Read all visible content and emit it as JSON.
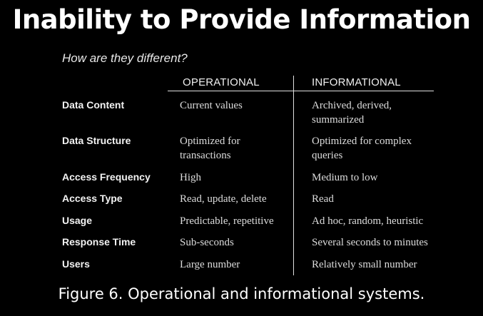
{
  "title": "Inability to Provide Information",
  "subtitle": "How are they different?",
  "columns": {
    "operational": "OPERATIONAL",
    "informational": "INFORMATIONAL"
  },
  "rows": [
    {
      "label": "Data Content",
      "operational": "Current values",
      "informational": "Archived, derived, summarized"
    },
    {
      "label": "Data Structure",
      "operational": "Optimized for transactions",
      "informational": "Optimized for complex queries"
    },
    {
      "label": "Access Frequency",
      "operational": "High",
      "informational": "Medium to low"
    },
    {
      "label": "Access Type",
      "operational": "Read, update, delete",
      "informational": "Read"
    },
    {
      "label": "Usage",
      "operational": "Predictable, repetitive",
      "informational": "Ad hoc, random, heuristic"
    },
    {
      "label": "Response Time",
      "operational": "Sub-seconds",
      "informational": "Several seconds to minutes"
    },
    {
      "label": "Users",
      "operational": "Large number",
      "informational": "Relatively small number"
    }
  ],
  "caption": "Figure 6. Operational and informational systems."
}
